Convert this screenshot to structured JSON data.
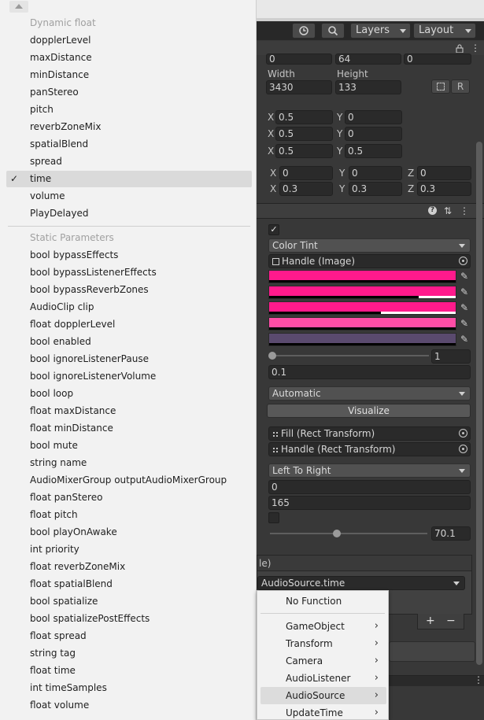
{
  "toolbar": {
    "layers_label": "Layers",
    "layout_label": "Layout"
  },
  "rect": {
    "pos_values": [
      "0",
      "64",
      "0"
    ],
    "width_label": "Width",
    "height_label": "Height",
    "width_value": "3430",
    "height_value": "133",
    "r_button": "R"
  },
  "anchors": {
    "rows": [
      {
        "x_label": "X",
        "x": "0.5",
        "y_label": "Y",
        "y": "0"
      },
      {
        "x_label": "X",
        "x": "0.5",
        "y_label": "Y",
        "y": "0"
      },
      {
        "x_label": "X",
        "x": "0.5",
        "y_label": "Y",
        "y": "0.5"
      }
    ]
  },
  "transform": {
    "rotation": {
      "x_label": "X",
      "x": "0",
      "y_label": "Y",
      "y": "0",
      "z_label": "Z",
      "z": "0"
    },
    "scale": {
      "x_label": "X",
      "x": "0.3",
      "y_label": "Y",
      "y": "0.3",
      "z_label": "Z",
      "z": "0.3"
    }
  },
  "slider_component": {
    "transition": "Color Tint",
    "target_graphic": "Handle (Image)",
    "colors": [
      "#ff1a8c",
      "#ff1a8c",
      "#ff1a8c",
      "#ff4da6",
      "#5a4a6e"
    ],
    "color_alpha": [
      1.0,
      0.8,
      0.6,
      1.0,
      1.0
    ],
    "fade_multiplier": "1",
    "fade_duration": "0.1",
    "navigation": "Automatic",
    "visualize_label": "Visualize",
    "fill_rect": "Fill (Rect Transform)",
    "handle_rect": "Handle (Rect Transform)",
    "direction": "Left To Right",
    "min_value": "0",
    "max_value": "165",
    "value": "70.1",
    "value_fraction": 0.425
  },
  "event": {
    "runtime_suffix": "le)",
    "function": "AudioSource.time",
    "plus": "+",
    "minus": "−"
  },
  "menu": {
    "dynamic_header": "Dynamic float",
    "dynamic_items": [
      "dopplerLevel",
      "maxDistance",
      "minDistance",
      "panStereo",
      "pitch",
      "reverbZoneMix",
      "spatialBlend",
      "spread",
      "time",
      "volume",
      "PlayDelayed"
    ],
    "selected_item": "time",
    "check_mark": "✓",
    "static_header": "Static Parameters",
    "static_items": [
      "bool bypassEffects",
      "bool bypassListenerEffects",
      "bool bypassReverbZones",
      "AudioClip clip",
      "float dopplerLevel",
      "bool enabled",
      "bool ignoreListenerPause",
      "bool ignoreListenerVolume",
      "bool loop",
      "float maxDistance",
      "float minDistance",
      "bool mute",
      "string name",
      "AudioMixerGroup outputAudioMixerGroup",
      "float panStereo",
      "float pitch",
      "bool playOnAwake",
      "int priority",
      "float reverbZoneMix",
      "float spatialBlend",
      "bool spatialize",
      "bool spatializePostEffects",
      "float spread",
      "string tag",
      "float time",
      "int timeSamples",
      "float volume"
    ]
  },
  "submenu": {
    "no_function": "No Function",
    "items": [
      "GameObject",
      "Transform",
      "Camera",
      "AudioListener",
      "AudioSource",
      "UpdateTime"
    ],
    "selected": "AudioSource",
    "chevron": "›"
  }
}
